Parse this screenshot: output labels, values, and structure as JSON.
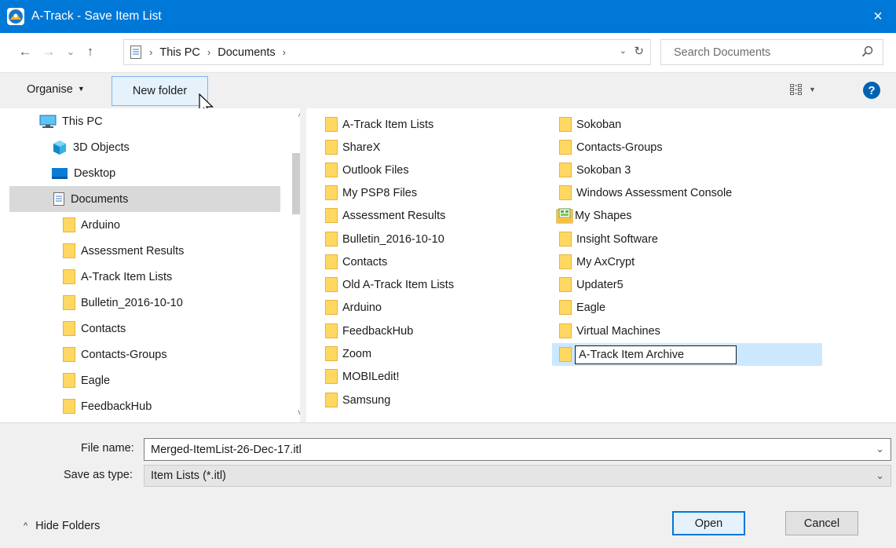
{
  "window": {
    "title": "A-Track - Save Item List",
    "close_icon": "×"
  },
  "address": {
    "back_icon": "←",
    "forward_icon": "→",
    "recent_icon": "⌄",
    "up_icon": "↑",
    "crumbs": [
      "This PC",
      "Documents"
    ],
    "dropdown_icon": "⌄",
    "refresh_icon": "↻",
    "separator": "›",
    "search_placeholder": "Search Documents"
  },
  "toolbar": {
    "organise_label": "Organise",
    "new_folder_label": "New folder",
    "help_label": "?"
  },
  "nav_pane": {
    "items": [
      {
        "label": "This PC",
        "icon": "pc-icon"
      },
      {
        "label": "3D Objects",
        "icon": "cube-icon"
      },
      {
        "label": "Desktop",
        "icon": "desktop-icon"
      },
      {
        "label": "Documents",
        "icon": "document-icon",
        "selected": true
      },
      {
        "label": "Arduino",
        "icon": "folder-icon"
      },
      {
        "label": "Assessment Results",
        "icon": "folder-icon"
      },
      {
        "label": "A-Track Item Lists",
        "icon": "folder-icon"
      },
      {
        "label": "Bulletin_2016-10-10",
        "icon": "folder-icon"
      },
      {
        "label": "Contacts",
        "icon": "folder-icon"
      },
      {
        "label": "Contacts-Groups",
        "icon": "folder-icon"
      },
      {
        "label": "Eagle",
        "icon": "folder-icon"
      },
      {
        "label": "FeedbackHub",
        "icon": "folder-icon"
      }
    ]
  },
  "content": {
    "column1": [
      "A-Track Item Lists",
      "ShareX",
      "Outlook Files",
      "My PSP8 Files",
      "Assessment Results",
      "Bulletin_2016-10-10",
      "Contacts",
      "Old A-Track Item Lists",
      "Arduino",
      "FeedbackHub",
      "Zoom",
      "MOBILedit!",
      "Samsung"
    ],
    "column2": [
      "Sokoban",
      "Contacts-Groups",
      "Sokoban 3",
      "Windows Assessment Console",
      "My Shapes",
      "Insight Software",
      "My AxCrypt",
      "Updater5",
      "Eagle",
      "Virtual Machines"
    ],
    "rename_value": "A-Track Item Archive"
  },
  "form": {
    "file_name_label": "File name:",
    "file_name_value": "Merged-ItemList-26-Dec-17.itl",
    "save_type_label": "Save as type:",
    "save_type_value": "Item Lists (*.itl)",
    "hide_folders_label": "Hide Folders",
    "open_label": "Open",
    "cancel_label": "Cancel"
  },
  "colors": {
    "titlebar": "#0078d7",
    "folder": "#ffd862",
    "selection": "#cce8ff"
  }
}
